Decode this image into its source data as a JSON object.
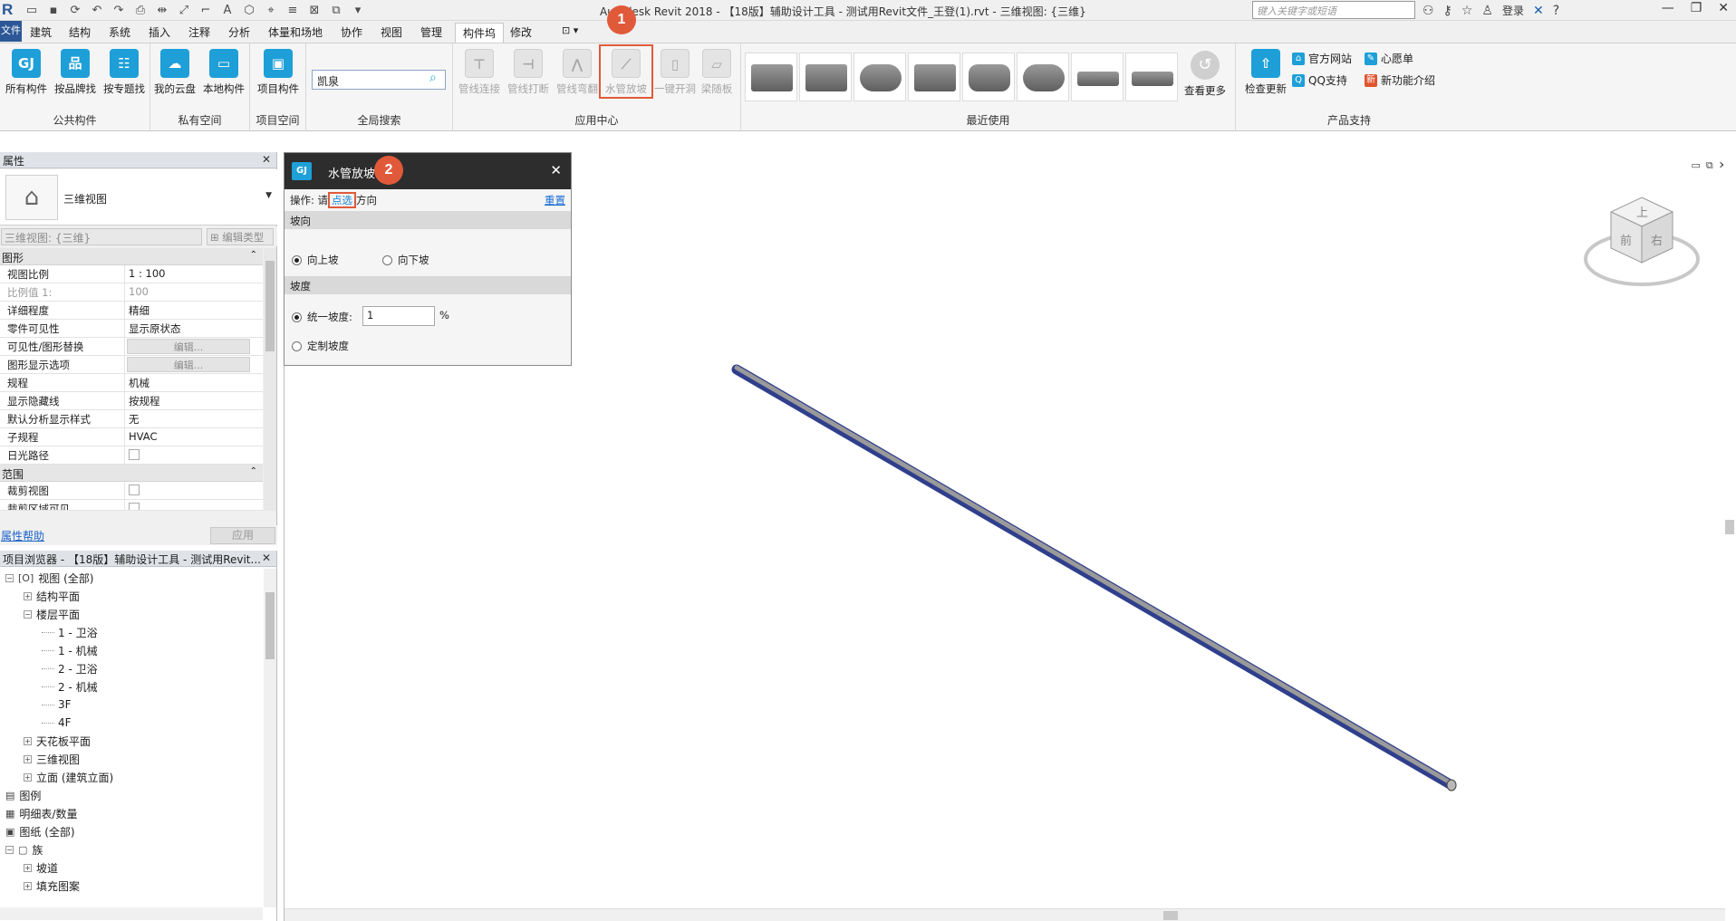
{
  "window": {
    "title": "Autodesk Revit 2018 -    【18版】辅助设计工具 - 测试用Revit文件_王登(1).rvt - 三维视图: {三维}",
    "search_placeholder": "键入关键字或短语",
    "login": "登录"
  },
  "ribbon": {
    "tabs": [
      "文件",
      "建筑",
      "结构",
      "系统",
      "插入",
      "注释",
      "分析",
      "体量和场地",
      "协作",
      "视图",
      "管理",
      "构件坞",
      "修改"
    ],
    "active_tab": "构件坞",
    "panels": {
      "public": {
        "title": "公共构件",
        "buttons": [
          "所有构件",
          "按品牌找",
          "按专题找"
        ]
      },
      "private": {
        "title": "私有空间",
        "buttons": [
          "我的云盘",
          "本地构件"
        ]
      },
      "project": {
        "title": "项目空间",
        "buttons": [
          "项目构件"
        ]
      },
      "search": {
        "title": "全局搜索",
        "value": "凯泉"
      },
      "apps": {
        "title": "应用中心",
        "buttons": [
          "管线连接",
          "管线打断",
          "管线弯翻",
          "水管放坡",
          "一键开洞",
          "梁随板"
        ]
      },
      "recent": {
        "title": "最近使用",
        "see_more": "查看更多"
      },
      "support": {
        "title": "产品支持",
        "update": "检查更新",
        "links": [
          "官方网站",
          "心愿单",
          "QQ支持",
          "新功能介绍"
        ]
      }
    }
  },
  "properties": {
    "title": "属性",
    "type_name": "三维视图",
    "instance_filter": "三维视图: {三维}",
    "edit_type": "编辑类型",
    "groups": [
      {
        "name": "图形",
        "rows": [
          {
            "k": "视图比例",
            "v": "1 : 100"
          },
          {
            "k": "比例值 1:",
            "v": "100"
          },
          {
            "k": "详细程度",
            "v": "精细"
          },
          {
            "k": "零件可见性",
            "v": "显示原状态"
          },
          {
            "k": "可见性/图形替换",
            "v": "编辑..."
          },
          {
            "k": "图形显示选项",
            "v": "编辑..."
          },
          {
            "k": "规程",
            "v": "机械"
          },
          {
            "k": "显示隐藏线",
            "v": "按规程"
          },
          {
            "k": "默认分析显示样式",
            "v": "无"
          },
          {
            "k": "子规程",
            "v": "HVAC"
          },
          {
            "k": "日光路径",
            "v": ""
          }
        ]
      },
      {
        "name": "范围",
        "rows": [
          {
            "k": "裁剪视图",
            "v": ""
          },
          {
            "k": "裁剪区域可见",
            "v": ""
          }
        ]
      }
    ],
    "help": "属性帮助",
    "apply": "应用"
  },
  "browser": {
    "title": "项目浏览器 - 【18版】辅助设计工具 - 测试用Revit...",
    "items": [
      {
        "label": "视图 (全部)",
        "depth": 0,
        "exp": "−",
        "icon": "[O]"
      },
      {
        "label": "结构平面",
        "depth": 1,
        "exp": "+"
      },
      {
        "label": "楼层平面",
        "depth": 1,
        "exp": "−"
      },
      {
        "label": "1 - 卫浴",
        "depth": 2
      },
      {
        "label": "1 - 机械",
        "depth": 2
      },
      {
        "label": "2 - 卫浴",
        "depth": 2
      },
      {
        "label": "2 - 机械",
        "depth": 2
      },
      {
        "label": "3F",
        "depth": 2
      },
      {
        "label": "4F",
        "depth": 2
      },
      {
        "label": "天花板平面",
        "depth": 1,
        "exp": "+"
      },
      {
        "label": "三维视图",
        "depth": 1,
        "exp": "+"
      },
      {
        "label": "立面 (建筑立面)",
        "depth": 1,
        "exp": "+"
      },
      {
        "label": "图例",
        "depth": 0,
        "icon": "▤"
      },
      {
        "label": "明细表/数量",
        "depth": 0,
        "icon": "▦"
      },
      {
        "label": "图纸 (全部)",
        "depth": 0,
        "icon": "▣"
      },
      {
        "label": "族",
        "depth": 0,
        "exp": "−",
        "icon": "▢"
      },
      {
        "label": "坡道",
        "depth": 1,
        "exp": "+"
      },
      {
        "label": "填充图案",
        "depth": 1,
        "exp": "+"
      }
    ]
  },
  "dialog": {
    "title": "水管放坡",
    "op_prefix": "操作: 请",
    "op_pick": "点选",
    "op_suffix": "方向",
    "reset": "重置",
    "section_direction": "坡向",
    "up": "向上坡",
    "down": "向下坡",
    "section_slope": "坡度",
    "uniform": "统一坡度:",
    "slope_value": "1",
    "unit": "%",
    "custom": "定制坡度"
  },
  "viewcube": {
    "top": "上",
    "front": "前",
    "right": "右"
  },
  "steps": [
    "1",
    "2"
  ]
}
